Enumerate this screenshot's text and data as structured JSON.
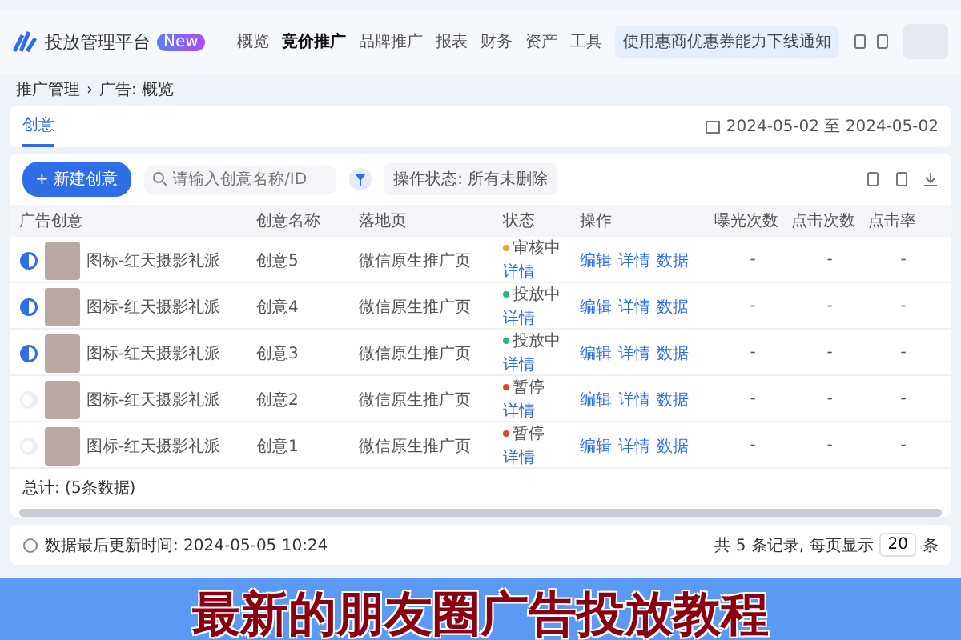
{
  "header": {
    "title": "投放管理平台",
    "badge": "New",
    "nav": [
      {
        "label": "概览",
        "selected": false
      },
      {
        "label": "竞价推广",
        "selected": true
      },
      {
        "label": "品牌推广",
        "selected": false
      },
      {
        "label": "报表",
        "selected": false
      },
      {
        "label": "财务",
        "selected": false
      },
      {
        "label": "资产",
        "selected": false
      },
      {
        "label": "工具",
        "selected": false
      }
    ],
    "notice": "使用惠商优惠券能力下线通知"
  },
  "breadcrumb": [
    "推广管理",
    "广告: 概览"
  ],
  "breadcrumb_separator": "›",
  "tabs": [
    {
      "label": "创意",
      "selected": true
    }
  ],
  "date_range": "2024-05-02 至 2024-05-02",
  "toolbar": {
    "new_button": "+ 新建创意",
    "search": {
      "placeholder": "请输入创意名称/ID"
    },
    "filter": "操作状态: 所有未删除"
  },
  "table": {
    "columns": [
      "广告创意",
      "创意名称",
      "落地页",
      "状态",
      "操作",
      "曝光次数",
      "点击次数",
      "点击率"
    ],
    "rows": [
      {
        "on": true,
        "ad": "图标-红天摄影礼派",
        "name": "创意5",
        "landing": "微信原生推广页",
        "status": "审核中",
        "color": "#f0a020",
        "detail": "详情",
        "actions": [
          "编辑",
          "详情",
          "数据"
        ],
        "metrics": [
          "-",
          "-",
          "-"
        ]
      },
      {
        "on": true,
        "ad": "图标-红天摄影礼派",
        "name": "创意4",
        "landing": "微信原生推广页",
        "status": "投放中",
        "color": "#2bb673",
        "detail": "详情",
        "actions": [
          "编辑",
          "详情",
          "数据"
        ],
        "metrics": [
          "-",
          "-",
          "-"
        ]
      },
      {
        "on": true,
        "ad": "图标-红天摄影礼派",
        "name": "创意3",
        "landing": "微信原生推广页",
        "status": "投放中",
        "color": "#2bb673",
        "detail": "详情",
        "actions": [
          "编辑",
          "详情",
          "数据"
        ],
        "metrics": [
          "-",
          "-",
          "-"
        ]
      },
      {
        "on": false,
        "ad": "图标-红天摄影礼派",
        "name": "创意2",
        "landing": "微信原生推广页",
        "status": "暂停",
        "color": "#e0443a",
        "detail": "详情",
        "actions": [
          "编辑",
          "详情",
          "数据"
        ],
        "metrics": [
          "-",
          "-",
          "-"
        ]
      },
      {
        "on": false,
        "ad": "图标-红天摄影礼派",
        "name": "创意1",
        "landing": "微信原生推广页",
        "status": "暂停",
        "color": "#e0443a",
        "detail": "详情",
        "actions": [
          "编辑",
          "详情",
          "数据"
        ],
        "metrics": [
          "-",
          "-",
          "-"
        ]
      }
    ],
    "total": "总计: (5条数据)"
  },
  "footer": {
    "updated": "数据最后更新时间: 2024-05-05 10:24",
    "records": "共 5 条记录, 每页显示",
    "page_size": "20",
    "unit": "条"
  },
  "caption": "最新的朋友圈广告投放教程"
}
